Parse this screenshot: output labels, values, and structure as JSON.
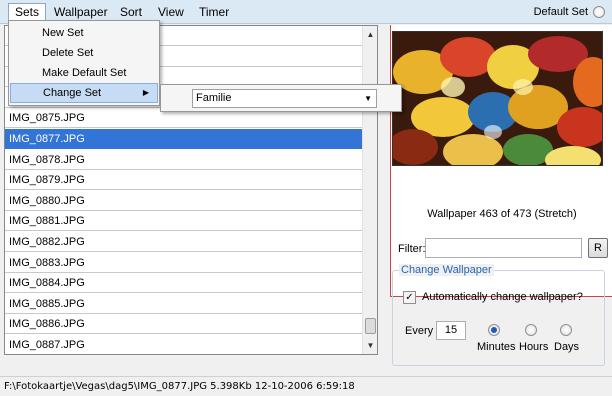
{
  "menubar": {
    "items": [
      "Sets",
      "Wallpaper",
      "Sort",
      "View",
      "Timer"
    ],
    "default_set_label": "Default Set"
  },
  "sets_menu": {
    "items": [
      "New Set",
      "Delete Set",
      "Make Default Set",
      "Change Set"
    ],
    "submenu_arrow": "▶",
    "submenu": {
      "selected_value": "Familie",
      "dropdown_arrow": "▼"
    }
  },
  "file_list": {
    "rows": [
      "",
      "",
      "",
      "",
      "IMG_0875.JPG",
      "IMG_0877.JPG",
      "IMG_0878.JPG",
      "IMG_0879.JPG",
      "IMG_0880.JPG",
      "IMG_0881.JPG",
      "IMG_0882.JPG",
      "IMG_0883.JPG",
      "IMG_0884.JPG",
      "IMG_0885.JPG",
      "IMG_0886.JPG",
      "IMG_0887.JPG"
    ],
    "selected_index": 5,
    "scroll_up": "▲",
    "scroll_down": "▼"
  },
  "preview": {
    "info": "Wallpaper 463 of 473 (Stretch)"
  },
  "filter": {
    "label": "Filter:",
    "value": "",
    "reset_button": "R"
  },
  "change_wallpaper": {
    "legend": "Change Wallpaper",
    "auto_label": "Automatically change wallpaper?",
    "auto_checked": true,
    "check_mark": "✓",
    "every_label": "Every",
    "every_value": "15",
    "units": [
      "Minutes",
      "Hours",
      "Days"
    ],
    "selected_unit": "Minutes"
  },
  "status": {
    "text": "F:\\Fotokaartje\\Vegas\\dag5\\IMG_0877.JPG   5.398Kb   12-10-2006 6:59:18"
  },
  "colors": {
    "menubar_bg": "#dbe9f5",
    "selection": "#3375d7",
    "accent_red": "#cc4444",
    "group_legend": "#2466b3"
  }
}
